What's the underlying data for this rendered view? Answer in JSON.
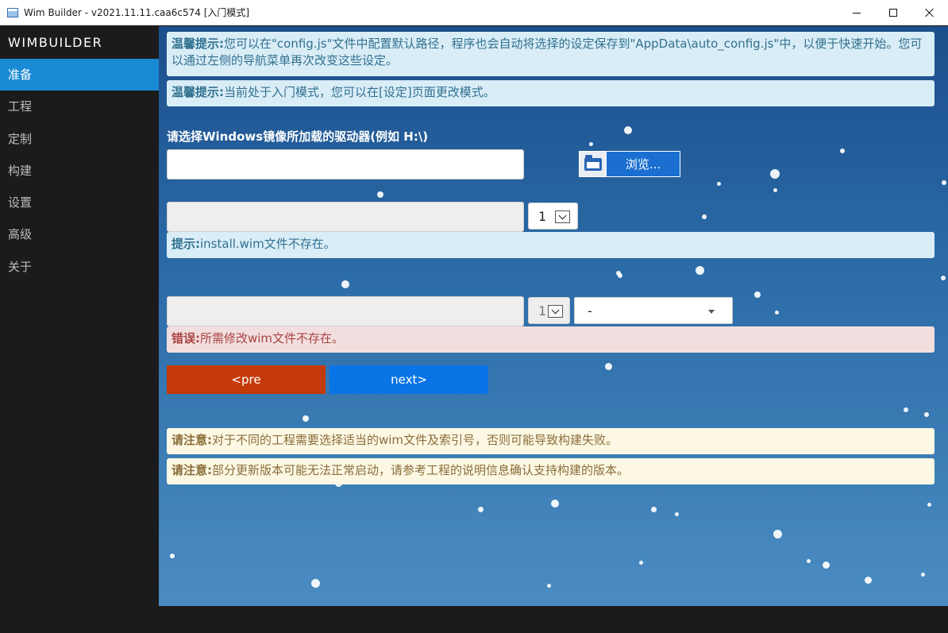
{
  "window": {
    "title": "Wim Builder - v2021.11.11.caa6c574 [入门模式]"
  },
  "sidebar": {
    "brand": "WIMBUILDER",
    "items": [
      {
        "label": "准备"
      },
      {
        "label": "工程"
      },
      {
        "label": "定制"
      },
      {
        "label": "构建"
      },
      {
        "label": "设置"
      },
      {
        "label": "高级"
      },
      {
        "label": "关于"
      }
    ]
  },
  "main": {
    "tip1": {
      "strong": "温馨提示:",
      "text": "您可以在\"config.js\"文件中配置默认路径，程序也会自动将选择的设定保存到\"AppData\\auto_config.js\"中，以便于快速开始。您可以通过左侧的导航菜单再次改变这些设定。"
    },
    "tip2": {
      "strong": "温馨提示:",
      "text": "当前处于入门模式，您可以在[设定]页面更改模式。"
    },
    "drive_label": "请选择Windows镜像所加载的驱动器(例如 H:\\)",
    "drive_input": {
      "value": "",
      "placeholder": ""
    },
    "browse_label": "浏览...",
    "install_wim": {
      "path": "",
      "index": "1"
    },
    "install_hint": {
      "strong": "提示:",
      "text": "install.wim文件不存在。"
    },
    "modify_wim": {
      "path": "",
      "index": "1",
      "dropdown": "-"
    },
    "error": {
      "strong": "错误:",
      "text": "所需修改wim文件不存在。"
    },
    "pre_label": "<pre",
    "next_label": "next>",
    "note1": {
      "strong": "请注意:",
      "text": "对于不同的工程需要选择适当的wim文件及索引号，否则可能导致构建失败。"
    },
    "note2": {
      "strong": "请注意:",
      "text": "部分更新版本可能无法正常启动，请参考工程的说明信息确认支持构建的版本。"
    }
  },
  "colors": {
    "accent": "#1a8ad4",
    "pre_button": "#c43a08",
    "next_button": "#0a74e6"
  }
}
